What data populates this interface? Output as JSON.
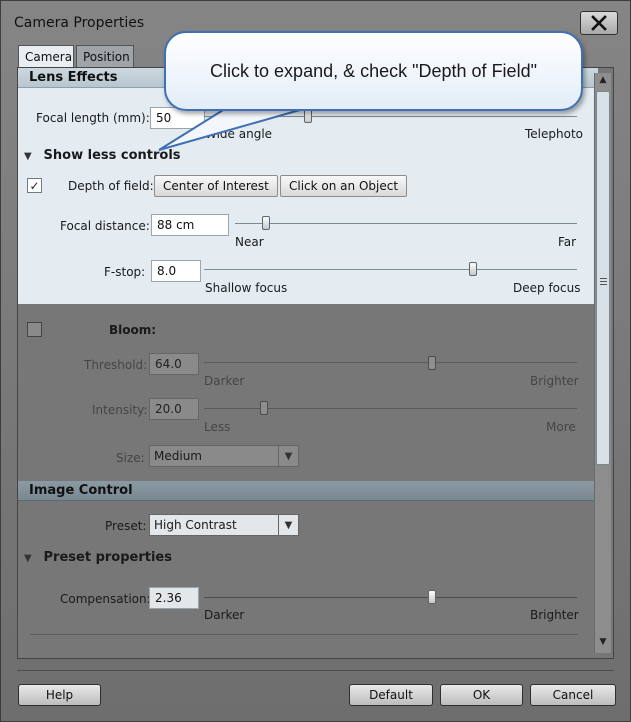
{
  "window": {
    "title": "Camera Properties"
  },
  "tabs": [
    {
      "label": "Camera"
    },
    {
      "label": "Position"
    }
  ],
  "callout": {
    "text": "Click to expand, & check \"Depth of Field\""
  },
  "lens_effects": {
    "header": "Lens Effects",
    "focal_length": {
      "label": "Focal length (mm):",
      "value": "50",
      "min_label": "Wide angle",
      "max_label": "Telephoto",
      "level": 0.28
    },
    "toggle_label": "Show less controls",
    "depth_of_field": {
      "label": "Depth of field:",
      "checked": true,
      "btn_center": "Center of Interest",
      "btn_object": "Click on an Object"
    },
    "focal_distance": {
      "label": "Focal distance:",
      "value": "88 cm",
      "min_label": "Near",
      "max_label": "Far",
      "level": 0.09
    },
    "fstop": {
      "label": "F-stop:",
      "value": "8.0",
      "min_label": "Shallow focus",
      "max_label": "Deep focus",
      "level": 0.72
    }
  },
  "bloom": {
    "label": "Bloom:",
    "checked": false,
    "threshold": {
      "label": "Threshold:",
      "value": "64.0",
      "min_label": "Darker",
      "max_label": "Brighter",
      "level": 0.61
    },
    "intensity": {
      "label": "Intensity:",
      "value": "20.0",
      "min_label": "Less",
      "max_label": "More",
      "level": 0.16
    },
    "size": {
      "label": "Size:",
      "value": "Medium"
    }
  },
  "image_control": {
    "header": "Image Control",
    "preset": {
      "label": "Preset:",
      "value": "High Contrast"
    },
    "toggle_label": "Preset properties",
    "compensation": {
      "label": "Compensation:",
      "value": "2.36",
      "min_label": "Darker",
      "max_label": "Brighter",
      "level": 0.61
    }
  },
  "footer": {
    "help": "Help",
    "default": "Default",
    "ok": "OK",
    "cancel": "Cancel"
  },
  "colors": {
    "callout_border": "#3f6fb4",
    "panel_light": "#e4ecf1"
  }
}
